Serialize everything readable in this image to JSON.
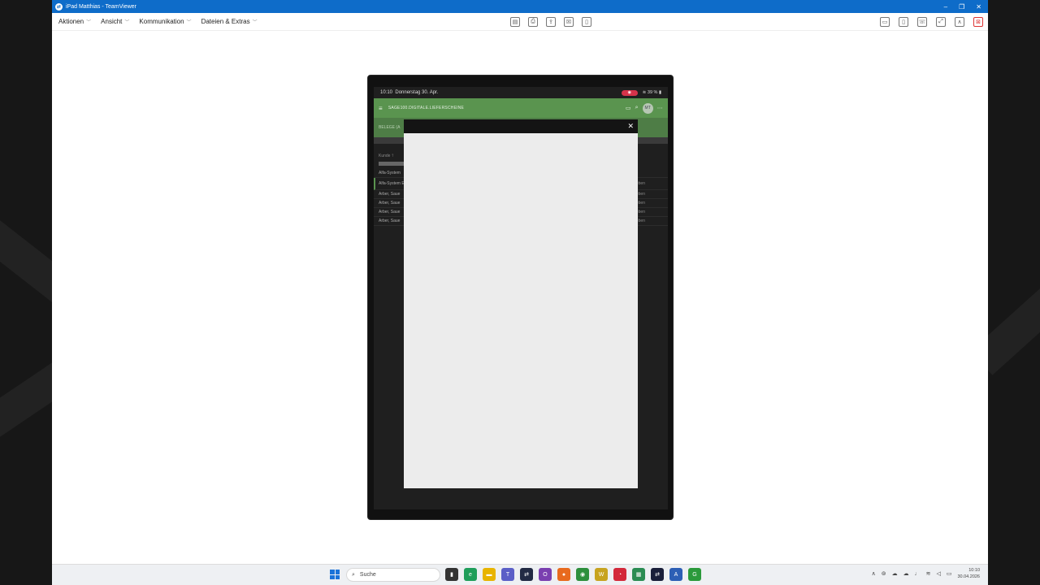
{
  "window": {
    "title": "iPad Matthias - TeamViewer",
    "controls": {
      "minimize": "–",
      "restore": "❐",
      "close": "✕"
    }
  },
  "menu": {
    "items": [
      "Aktionen",
      "Ansicht",
      "Kommunikation",
      "Dateien & Extras"
    ]
  },
  "toolbar": {
    "center_icons": [
      "▤",
      "⎙",
      "⇪",
      "☒",
      "▯"
    ],
    "right_icons": [
      "▭",
      "▯",
      "☏",
      "⤢",
      "∧",
      "⊠"
    ]
  },
  "ipad": {
    "status": {
      "time": "10:10",
      "date": "Donnerstag 30. Apr.",
      "battery": "39 %"
    },
    "app": {
      "title": "SAGE100.DIGITALE.LIEFERSCHEINE",
      "avatar": "MT",
      "subbar": "BELEGE (A",
      "list_header": "Kunde 🡑",
      "rows": [
        {
          "left": "Alfa-System",
          "right": ""
        },
        {
          "left": "Alfa-System E/W",
          "right": "eben"
        },
        {
          "left": "Arber, Saue",
          "right": "eben"
        },
        {
          "left": "Arber, Saue",
          "right": "eben"
        },
        {
          "left": "Arber, Saue",
          "right": "eben"
        },
        {
          "left": "Arber, Saue",
          "right": "eben"
        }
      ]
    },
    "modal": {
      "close": "✕"
    }
  },
  "taskbar": {
    "search_label": "Suche",
    "clock_time": "10:10",
    "clock_date": "30.04.2026",
    "icons": [
      {
        "glyph": "▮",
        "color": "#333333"
      },
      {
        "glyph": "e",
        "color": "#1f9e5a"
      },
      {
        "glyph": "▬",
        "color": "#e8b400"
      },
      {
        "glyph": "T",
        "color": "#5b5fc7"
      },
      {
        "glyph": "⇄",
        "color": "#222a44"
      },
      {
        "glyph": "O",
        "color": "#7a3fb0"
      },
      {
        "glyph": "●",
        "color": "#e86a1e"
      },
      {
        "glyph": "◉",
        "color": "#2d8f3c"
      },
      {
        "glyph": "W",
        "color": "#c7a31f"
      },
      {
        "glyph": "◔",
        "color": "#d3283a"
      },
      {
        "glyph": "▦",
        "color": "#2a8c52"
      },
      {
        "glyph": "⇄",
        "color": "#1a1f3a"
      },
      {
        "glyph": "A",
        "color": "#2d5fb5"
      },
      {
        "glyph": "G",
        "color": "#2b9a3b"
      }
    ]
  }
}
